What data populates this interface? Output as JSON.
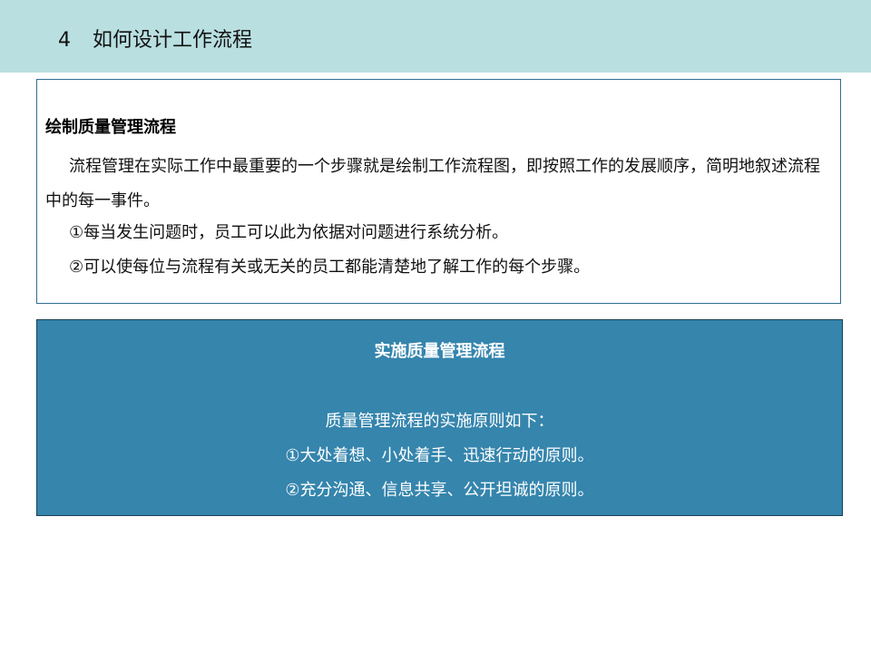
{
  "header": {
    "number": "4",
    "title": "如何设计工作流程"
  },
  "draw_section": {
    "heading": "绘制质量管理流程",
    "paragraph": "流程管理在实际工作中最重要的一个步骤就是绘制工作流程图，即按照工作的发展顺序，简明地叙述流程中的每一事件。",
    "points": [
      "①每当发生问题时，员工可以此为依据对问题进行系统分析。",
      "②可以使每位与流程有关或无关的员工都能清楚地了解工作的每个步骤。"
    ]
  },
  "implement_section": {
    "heading": "实施质量管理流程",
    "intro": "质量管理流程的实施原则如下：",
    "points": [
      "①大处着想、小处着手、迅速行动的原则。",
      "②充分沟通、信息共享、公开坦诚的原则。"
    ]
  },
  "colors": {
    "header_bar": "#b9dfe1",
    "top_box_border": "#2f6f8f",
    "bottom_box_fill": "#3585ad"
  }
}
